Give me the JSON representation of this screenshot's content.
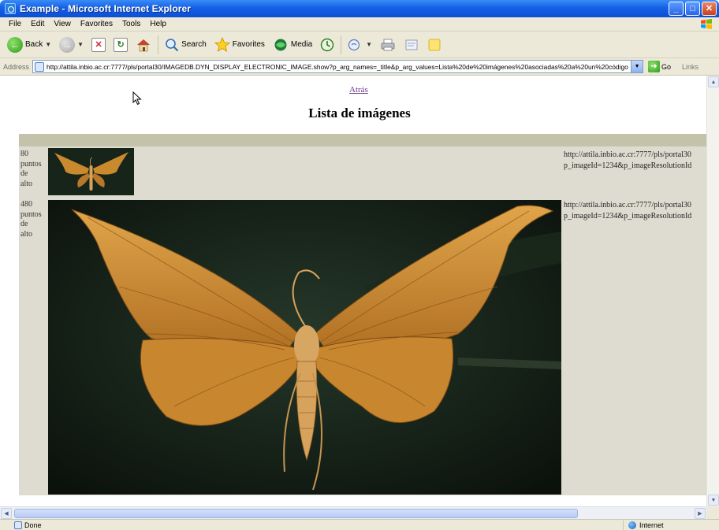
{
  "window": {
    "title": "Example - Microsoft Internet Explorer",
    "minimize": "_",
    "maximize": "□",
    "close": "✕"
  },
  "menu": [
    "File",
    "Edit",
    "View",
    "Favorites",
    "Tools",
    "Help"
  ],
  "toolbar": {
    "back": "Back",
    "search": "Search",
    "favorites": "Favorites",
    "media": "Media"
  },
  "address": {
    "label": "Address",
    "url": "http://attila.inbio.ac.cr:7777/pls/portal30/IMAGEDB.DYN_DISPLAY_ELECTRONIC_IMAGE.show?p_arg_names=_title&p_arg_values=Lista%20de%20imágenes%20asociadas%20a%20un%20código",
    "go": "Go",
    "links": "Links"
  },
  "page": {
    "back_link": "Atrás",
    "title": "Lista de imágenes"
  },
  "rows": [
    {
      "size_label": [
        "80",
        "puntos",
        "de",
        "alto"
      ],
      "url_line1": "http://attila.inbio.ac.cr:7777/pls/portal30",
      "url_line2": "p_imageId=1234&p_imageResolutionId"
    },
    {
      "size_label": [
        "480",
        "puntos",
        "de",
        "alto"
      ],
      "url_line1": "http://attila.inbio.ac.cr:7777/pls/portal30",
      "url_line2": "p_imageId=1234&p_imageResolutionId"
    }
  ],
  "status": {
    "left": "Done",
    "zone": "Internet"
  },
  "colors": {
    "titlebar": "#0b4fd4",
    "chrome": "#ece9d8",
    "table_bg": "#dedcd0",
    "header_row": "#c4c2ab",
    "visited_link": "#6c3b8f"
  }
}
